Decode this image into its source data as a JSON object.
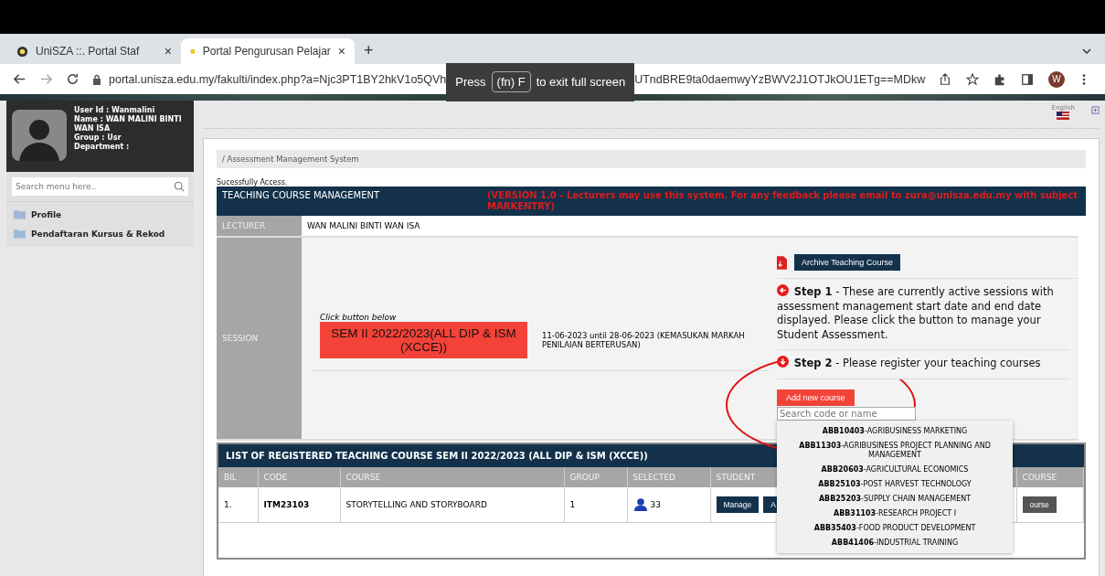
{
  "browser": {
    "tabs": [
      {
        "title": "UniSZA ::. Portal Staf",
        "close": "×",
        "selected": false
      },
      {
        "title": "Portal Pengurusan Pelajar",
        "close": "×",
        "selected": true
      }
    ],
    "new_tab": "+",
    "url_start": "portal.unisza.edu.my/fakulti/index.php?a=Njc3PT1BY2hkV1o5QVh",
    "url_end": "UTndBRE9ta0daemwyYzBWV2J1OTJkOU1ETg==MDkw",
    "profile": "W"
  },
  "fullscreen_toast": {
    "before": "Press",
    "key": "(fn) F",
    "after": "to exit full screen"
  },
  "user": {
    "lines": [
      "User Id : Wanmalini",
      "Name : WAN MALINI BINTI WAN ISA",
      "Group : Usr",
      "Department :"
    ]
  },
  "sidebar": {
    "search": {
      "placeholder": "Search menu here.."
    },
    "items": [
      {
        "label": "Profile"
      },
      {
        "label": "Pendaftaran Kursus & Rekod"
      }
    ]
  },
  "language": "English",
  "breadcrumb": "/ Assessment Management System",
  "notice": "Sucessfully Access.",
  "panel": {
    "title": "TEACHING COURSE MANAGEMENT",
    "version_note": "(VERSION 1.0 - Lecturers may use this system. For any feedback please email to zura@unisza.edu.my with subject MARKENTRY)"
  },
  "lecturer": {
    "label": "LECTURER",
    "value": "WAN MALINI BINTI WAN ISA"
  },
  "session": {
    "label": "SESSION",
    "hint": "Click button below",
    "button": "SEM II 2022/2023(ALL DIP & ISM (XCCE))",
    "dates": "11-06-2023 until 28-06-2023 (KEMASUKAN MARKAH PENILAIAN BERTERUSAN)",
    "archive_button": "Archive Teaching Course",
    "steps": [
      {
        "title": "Step 1",
        "text": " - These are currently active sessions with assessment management start date and end date displayed. Please click the button to manage your Student Assessment.",
        "kind": "left"
      },
      {
        "title": "Step 2",
        "text": " - Please register your teaching courses",
        "kind": "down"
      }
    ],
    "add_button": "Add new course",
    "course_search": {
      "placeholder": "Search code or name"
    },
    "course_options": [
      {
        "code": "ABB10403",
        "name": "-AGRIBUSINESS MARKETING"
      },
      {
        "code": "ABB11303",
        "name": "-AGRIBUSINESS PROJECT PLANNING AND MANAGEMENT"
      },
      {
        "code": "ABB20603",
        "name": "-AGRICULTURAL ECONOMICS"
      },
      {
        "code": "ABB25103",
        "name": "-POST HARVEST TECHNOLOGY"
      },
      {
        "code": "ABB25203",
        "name": "-SUPPLY CHAIN MANAGEMENT"
      },
      {
        "code": "ABB31103",
        "name": "-RESEARCH PROJECT I"
      },
      {
        "code": "ABB35403",
        "name": "-FOOD PRODUCT DEVELOPMENT"
      },
      {
        "code": "ABB41406",
        "name": "-INDUSTRIAL TRAINING"
      }
    ]
  },
  "registered": {
    "title": "LIST OF REGISTERED TEACHING COURSE SEM II 2022/2023 (ALL DIP & ISM (XCCE))",
    "columns": [
      "BIL",
      "CODE",
      "COURSE",
      "GROUP",
      "SELECTED",
      "STUDENT",
      "COURSE"
    ],
    "rows": [
      {
        "bil": "1.",
        "code": "ITM23103",
        "course": "STORYTELLING AND STORYBOARD",
        "group": "1",
        "selected": "33",
        "buttons": [
          "Manage",
          "A"
        ],
        "last_button": "ourse"
      }
    ]
  }
}
